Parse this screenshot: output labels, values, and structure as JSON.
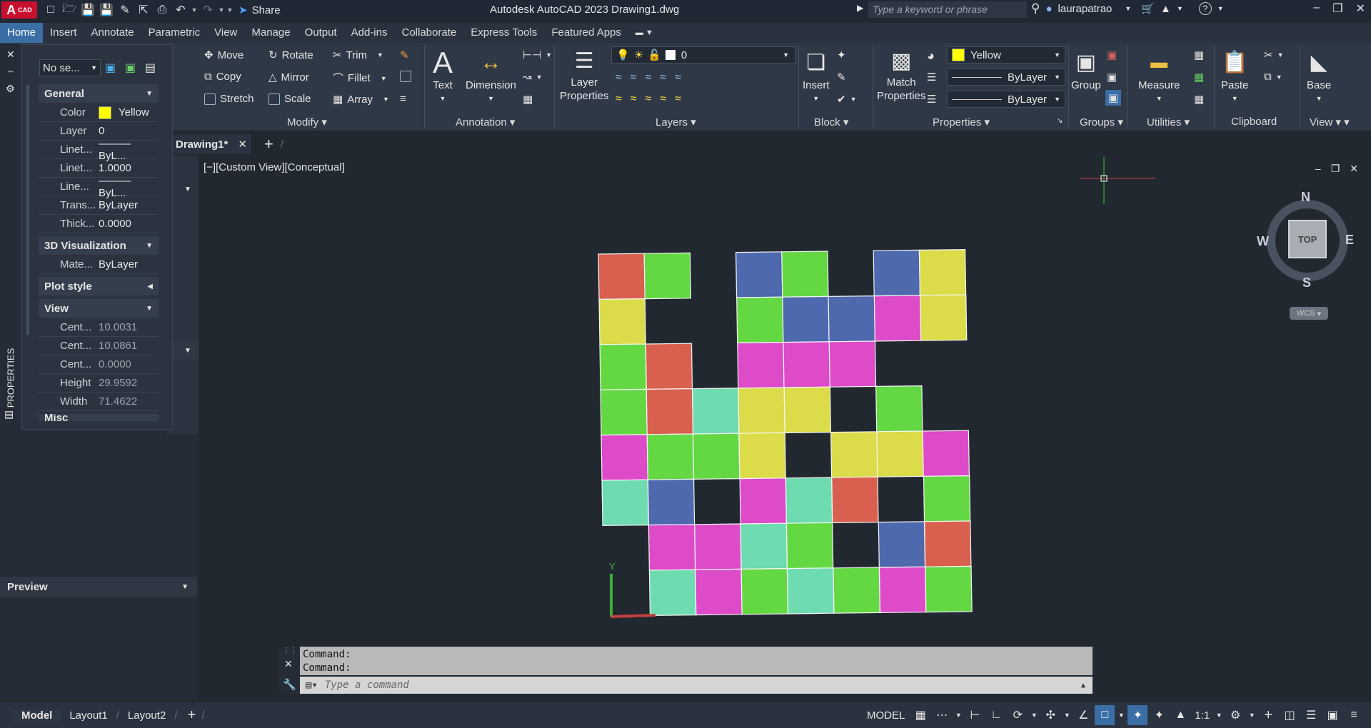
{
  "title_bar": {
    "logo": "CAD",
    "share_label": "Share",
    "app_title": "Autodesk AutoCAD 2023    Drawing1.dwg",
    "search_placeholder": "Type a keyword or phrase",
    "user_name": "laurapatrao"
  },
  "menu": {
    "tabs": [
      "Home",
      "Insert",
      "Annotate",
      "Parametric",
      "View",
      "Manage",
      "Output",
      "Add-ins",
      "Collaborate",
      "Express Tools",
      "Featured Apps"
    ]
  },
  "ribbon": {
    "modify": {
      "move": "Move",
      "rotate": "Rotate",
      "trim": "Trim",
      "copy": "Copy",
      "mirror": "Mirror",
      "fillet": "Fillet",
      "stretch": "Stretch",
      "scale": "Scale",
      "array": "Array",
      "title": "Modify"
    },
    "annotation": {
      "text": "Text",
      "dimension": "Dimension",
      "title": "Annotation"
    },
    "layers": {
      "layer_properties_1": "Layer",
      "layer_properties_2": "Properties",
      "current_layer": "0",
      "title": "Layers"
    },
    "block": {
      "insert": "Insert",
      "title": "Block"
    },
    "properties": {
      "match_1": "Match",
      "match_2": "Properties",
      "color": "Yellow",
      "linetype": "ByLayer",
      "lineweight": "ByLayer",
      "title": "Properties"
    },
    "groups": {
      "group": "Group",
      "title": "Groups"
    },
    "utilities": {
      "measure": "Measure",
      "title": "Utilities"
    },
    "clipboard": {
      "paste": "Paste",
      "title": "Clipboard"
    },
    "view": {
      "base": "Base",
      "title": "View"
    }
  },
  "doc_tabs": {
    "active": "Drawing1*"
  },
  "viewport": {
    "label": "[−][Custom View][Conceptual]",
    "cube_face": "TOP",
    "wcs": "WCS",
    "north": "N",
    "south": "S",
    "east": "E",
    "west": "W",
    "ucs_y": "Y"
  },
  "properties_palette": {
    "selection": "No se...",
    "side_title": "PROPERTIES",
    "sections": {
      "general": "General",
      "vis3d": "3D Visualization",
      "plot": "Plot style",
      "view": "View",
      "misc": "Misc"
    },
    "general": [
      {
        "k": "Color",
        "v": "Yellow"
      },
      {
        "k": "Layer",
        "v": "0"
      },
      {
        "k": "Linet...",
        "v": "——— ByL..."
      },
      {
        "k": "Linet...",
        "v": "1.0000"
      },
      {
        "k": "Line...",
        "v": "——— ByL..."
      },
      {
        "k": "Trans...",
        "v": "ByLayer"
      },
      {
        "k": "Thick...",
        "v": "0.0000"
      }
    ],
    "vis3d": [
      {
        "k": "Mate...",
        "v": "ByLayer"
      }
    ],
    "view": [
      {
        "k": "Cent...",
        "v": "10.0031"
      },
      {
        "k": "Cent...",
        "v": "10.0861"
      },
      {
        "k": "Cent...",
        "v": "0.0000"
      },
      {
        "k": "Height",
        "v": "29.9592"
      },
      {
        "k": "Width",
        "v": "71.4622"
      }
    ]
  },
  "preview": {
    "title": "Preview"
  },
  "command": {
    "line1": "Command:",
    "line2": "Command:",
    "placeholder": "Type a command"
  },
  "status_bar": {
    "tabs": [
      "Model",
      "Layout1",
      "Layout2"
    ],
    "model": "MODEL",
    "scale": "1:1"
  },
  "colors": {
    "red": "#d9604f",
    "green": "#63d843",
    "yellow": "#dcdc4a",
    "blue": "#4f69ae",
    "magenta": "#dd4bc8",
    "teal": "#6edcb0"
  },
  "grid": [
    [
      "red",
      "green",
      null,
      "blue",
      "green",
      null,
      "blue",
      "yellow"
    ],
    [
      "yellow",
      null,
      null,
      "green",
      "blue",
      "blue",
      "magenta",
      "yellow"
    ],
    [
      "green",
      "red",
      null,
      "magenta",
      "magenta",
      "magenta",
      null,
      null
    ],
    [
      "green",
      "red",
      "teal",
      "yellow",
      "yellow",
      null,
      "green",
      null
    ],
    [
      "magenta",
      "green",
      "green",
      "yellow",
      null,
      "yellow",
      "yellow",
      "magenta"
    ],
    [
      "teal",
      "blue",
      null,
      "magenta",
      "teal",
      "red",
      null,
      "green"
    ],
    [
      null,
      "magenta",
      "magenta",
      "teal",
      "green",
      null,
      "blue",
      "red"
    ],
    [
      null,
      "teal",
      "magenta",
      "green",
      "teal",
      "green",
      "magenta",
      "green"
    ]
  ]
}
